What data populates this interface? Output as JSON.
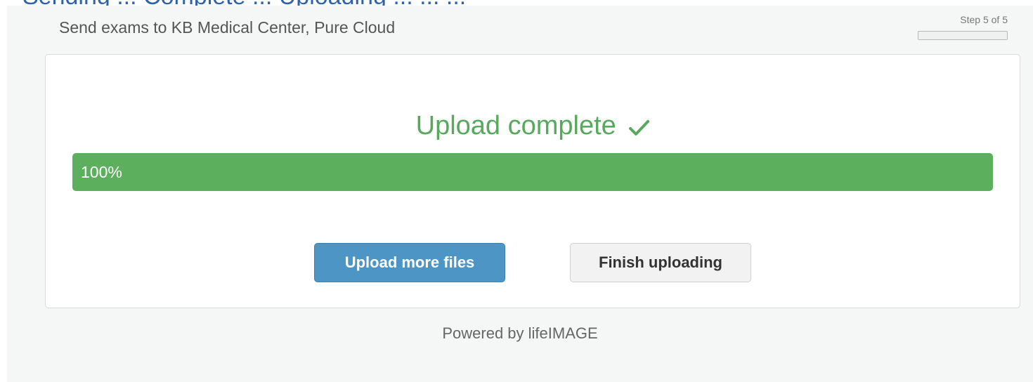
{
  "page": {
    "top_title_partial": "Sending ... Complete ... Uploading ... ... ...",
    "header": {
      "destination_text": "Send exams to KB Medical Center, Pure Cloud",
      "step_text": "Step 5 of 5",
      "step_progress_fraction": 0
    },
    "card": {
      "status_title": "Upload complete",
      "status_icon": "check-icon",
      "progress": {
        "percent": 100,
        "label": "100%"
      },
      "buttons": {
        "upload_more_label": "Upload more files",
        "finish_label": "Finish uploading"
      }
    },
    "footer": {
      "powered_by": "Powered by lifeIMAGE"
    },
    "colors": {
      "success": "#56a95d",
      "primary": "#4d95c4",
      "muted_text": "#666666"
    }
  }
}
